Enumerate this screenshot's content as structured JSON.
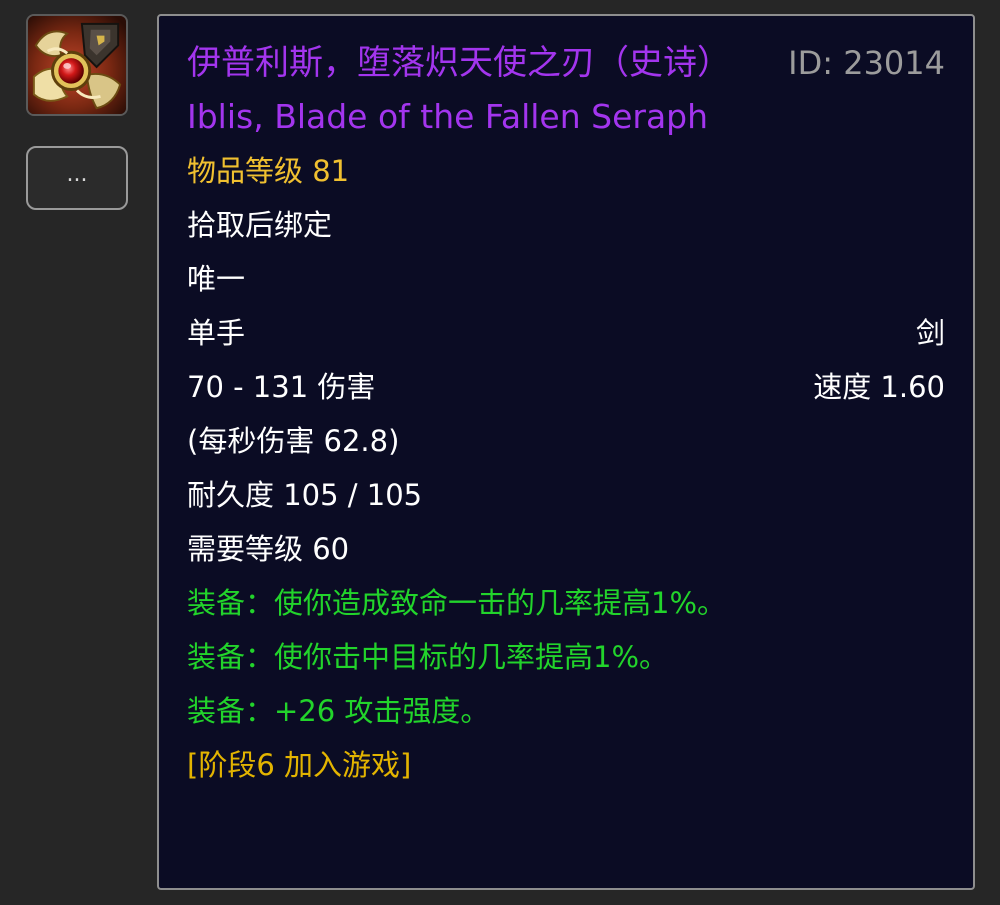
{
  "icon": {
    "name": "sword-item-icon"
  },
  "more_button": {
    "label": "..."
  },
  "item": {
    "name_cn": "伊普利斯，堕落炽天使之刃（史诗）",
    "id_label": "ID: 23014",
    "name_en": "Iblis, Blade of the Fallen Seraph",
    "item_level": "物品等级 81",
    "binding": "拾取后绑定",
    "unique": "唯一",
    "slot": "单手",
    "type": "剑",
    "damage": "70 - 131 伤害",
    "speed": "速度 1.60",
    "dps": "(每秒伤害 62.8)",
    "durability": "耐久度 105 / 105",
    "required_level": "需要等级 60",
    "equip_effects": [
      "装备：使你造成致命一击的几率提高1%。",
      "装备：使你击中目标的几率提高1%。",
      "装备：+26 攻击强度。"
    ],
    "phase": "[阶段6 加入游戏]"
  },
  "colors": {
    "epic": "#a335ee",
    "item_level": "#f0c030",
    "equip": "#22d42b",
    "phase": "#e3b400",
    "tooltip_bg": "#0b0c24"
  }
}
